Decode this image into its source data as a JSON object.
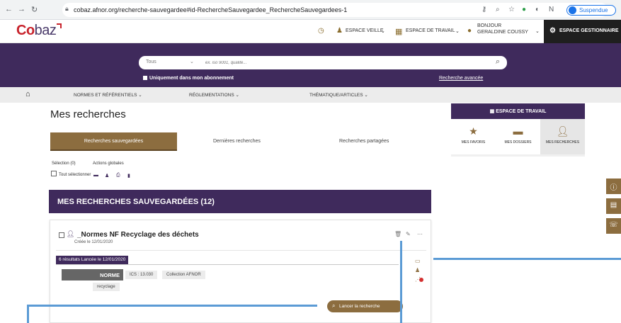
{
  "browser": {
    "url": "cobaz.afnor.org/recherche-sauvegardee#id-RechercheSauvegardee_RechercheSauvegardees-1",
    "profile_label": "Suspendue"
  },
  "header": {
    "logo": {
      "c": "C",
      "o": "o",
      "rest": "baz"
    },
    "veille_label": "ESPACE VEILLE",
    "travail_label": "ESPACE DE TRAVAIL",
    "greeting_line1": "BONJOUR",
    "greeting_line2": "GERALDINE COUSSY",
    "gestionnaire_label": "ESPACE GESTIONNAIRE"
  },
  "search": {
    "scope": "Tous",
    "placeholder": "ex. iso 9001, qualité...",
    "subscription_label": "Uniquement dans mon abonnement",
    "advanced_link": "Recherche avancée"
  },
  "menu": {
    "items": [
      {
        "label": "NORMES ET RÉFÉRENTIELS ⌄"
      },
      {
        "label": "RÉGLEMENTATIONS ⌄"
      },
      {
        "label": "THÉMATIQUE/ARTICLES ⌄"
      }
    ]
  },
  "main": {
    "title": "Mes recherches",
    "tabs": [
      {
        "label": "Recherches sauvegardées",
        "active": true
      },
      {
        "label": "Dernières recherches"
      },
      {
        "label": "Recherches partagées"
      }
    ],
    "selection_label": "Sélection (0)",
    "actions_label": "Actions globales",
    "select_all_label": "Tout sélectionner",
    "banner": "MES RECHERCHES SAUVEGARDÉES (12)"
  },
  "saved_search": {
    "name": "_Normes NF Recyclage des déchets",
    "created": "Créée le 12/01/2020",
    "results": "6 résultats   Lancée le 12/01/2020",
    "type": "NORME",
    "ics": "ICS : 13.030",
    "collection": "Collection AFNOR",
    "keyword": "recyclage",
    "launch_label": "Lancer la recherche"
  },
  "workspace": {
    "title": "ESPACE DE TRAVAIL",
    "options": [
      {
        "label": "MES FAVORIS",
        "icon": "star-icon"
      },
      {
        "label": "MES DOSSIERS",
        "icon": "folder-icon"
      },
      {
        "label": "MES RECHERCHES",
        "icon": "user-search-icon",
        "active": true
      }
    ]
  },
  "colors": {
    "primary_purple": "#3f2a5c",
    "accent_brown": "#8c6d3f",
    "annotation_blue": "#5b9bd5"
  }
}
